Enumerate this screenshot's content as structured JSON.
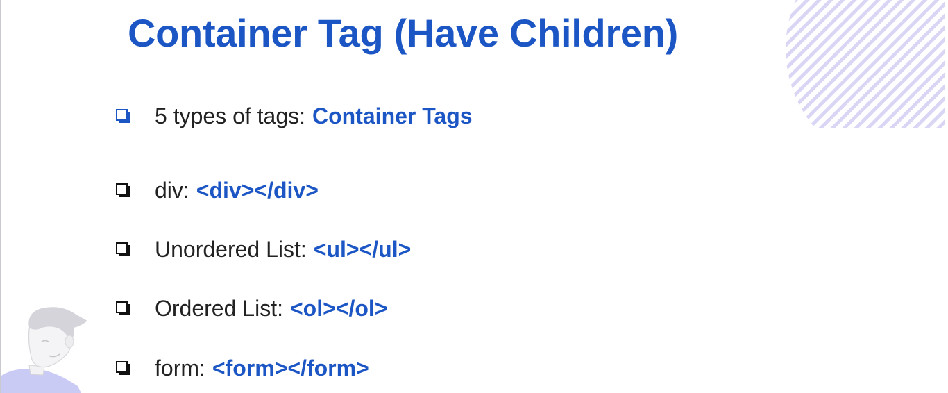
{
  "slide": {
    "title": "Container Tag (Have Children)",
    "intro": {
      "label": "5 types of tags:",
      "highlight": "Container Tags"
    },
    "items": [
      {
        "label": "div:",
        "code": "<div></div>"
      },
      {
        "label": "Unordered List:",
        "code": "<ul></ul>"
      },
      {
        "label": "Ordered List:",
        "code": "<ol></ol>"
      },
      {
        "label": "form:",
        "code": "<form></form>"
      }
    ]
  },
  "colors": {
    "accent": "#1c56c4",
    "text": "#222222",
    "decoration": "#d9d6f5"
  },
  "icons": {
    "bullet": "checkbox-shadow-icon",
    "corner_decoration": "diagonal-stripes-circle",
    "illustration": "person-illustration"
  }
}
